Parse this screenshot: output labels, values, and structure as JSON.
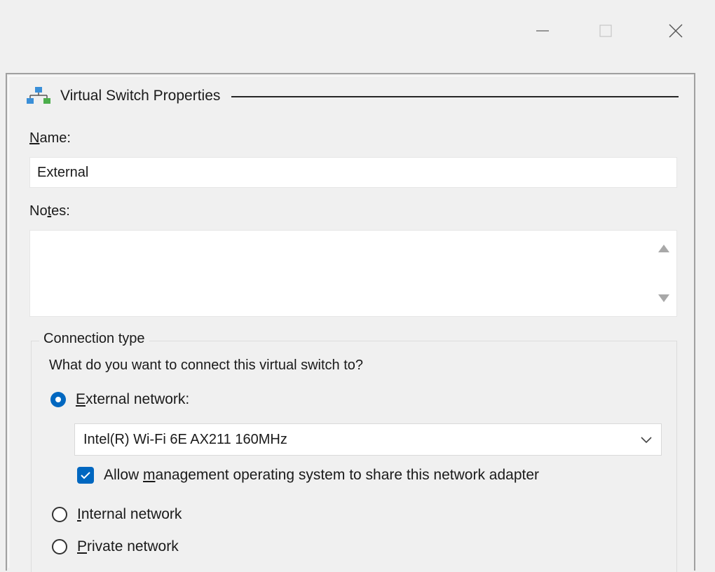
{
  "window": {
    "controls": {
      "minimize_icon": "minimize-icon",
      "maximize_icon": "maximize-icon",
      "close_icon": "close-icon"
    }
  },
  "section": {
    "icon": "network-icon",
    "title": "Virtual Switch Properties"
  },
  "name": {
    "label_prefix": "",
    "label_access": "N",
    "label_rest": "ame:",
    "value": "External"
  },
  "notes": {
    "label_prefix": "No",
    "label_access": "t",
    "label_rest": "es:",
    "value": ""
  },
  "connection": {
    "group_title": "Connection type",
    "question": "What do you want to connect this virtual switch to?",
    "external": {
      "access": "E",
      "rest": "xternal network:",
      "selected": true
    },
    "adapter_selected": "Intel(R) Wi-Fi 6E AX211 160MHz",
    "allow_mgmt": {
      "prefix": "Allow ",
      "access": "m",
      "rest": "anagement operating system to share this network adapter",
      "checked": true
    },
    "internal": {
      "access": "I",
      "rest": "nternal network",
      "selected": false
    },
    "private": {
      "access": "P",
      "rest": "rivate network",
      "selected": false
    }
  },
  "colors": {
    "accent": "#0067c0",
    "background": "#f0f0f0"
  }
}
